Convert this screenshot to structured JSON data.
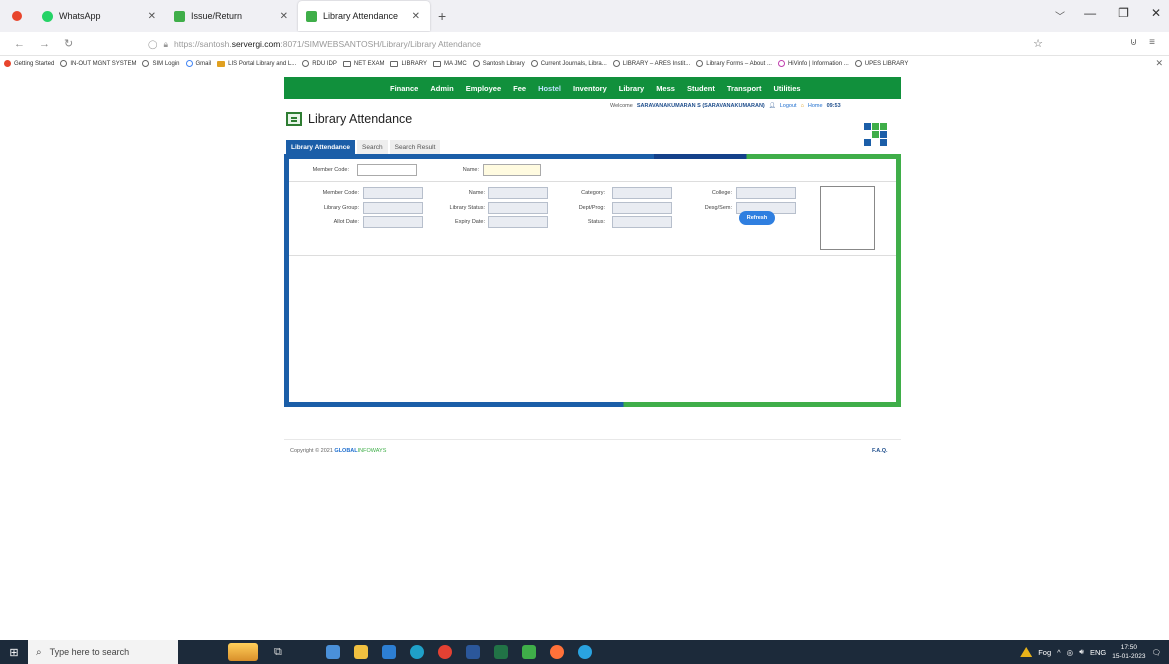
{
  "browser": {
    "tabs": [
      {
        "title": "WhatsApp",
        "color": "#25d366"
      },
      {
        "title": "Issue/Return",
        "color": "#3fae49"
      },
      {
        "title": "Library Attendance",
        "color": "#3fae49"
      }
    ],
    "url_prefix": "https://santosh.",
    "url_host": "servergi.com",
    "url_suffix": ":8071/SIMWEBSANTOSH/Library/Library Attendance",
    "bookmarks": [
      "Getting Started",
      "IN-OUT MGNT SYSTEM",
      "SIM Login",
      "Gmail",
      "LIS Portal Library and L...",
      "RDU IDP",
      "NET EXAM",
      "LIBRARY",
      "MA JMC",
      "Santosh Library",
      "Current Journals, Libra...",
      "LIBRARY – ARES Instit...",
      "Library Forms – About ...",
      "HiVinfo | Information ...",
      "UPES LIBRARY"
    ]
  },
  "app": {
    "menu": [
      "Finance",
      "Admin",
      "Employee",
      "Fee",
      "Hostel",
      "Inventory",
      "Library",
      "Mess",
      "Student",
      "Transport",
      "Utilities"
    ],
    "welcome_label": "Welcome",
    "user": "SARAVANAKUMARAN S (SARAVANAKUMARAN)",
    "logout": "Logout",
    "home": "Home",
    "time": "09:53",
    "page_title": "Library Attendance",
    "subtabs": [
      "Library Attendance",
      "Search",
      "Search Result"
    ],
    "form": {
      "member_code_label": "Member Code:",
      "name_label": "Name:",
      "category_label": "Category:",
      "college_label": "College:",
      "library_group_label": "Library Group:",
      "library_status_label": "Library Status:",
      "dept_prog_label": "Dept/Prog:",
      "desg_sem_label": "Desg/Sem:",
      "allot_date_label": "Allot Date:",
      "expiry_date_label": "Expiry Date:",
      "status_label": "Status:",
      "refresh": "Refresh"
    },
    "footer": {
      "copyright_prefix": "Copyright © 2021",
      "brand": "GLOBAL",
      "brand2": "INFOWAYS",
      "faq": "F.A.Q."
    }
  },
  "taskbar": {
    "search_placeholder": "Type here to search",
    "weather": "Fog",
    "language": "ENG",
    "time": "17:50",
    "date": "15-01-2023"
  }
}
